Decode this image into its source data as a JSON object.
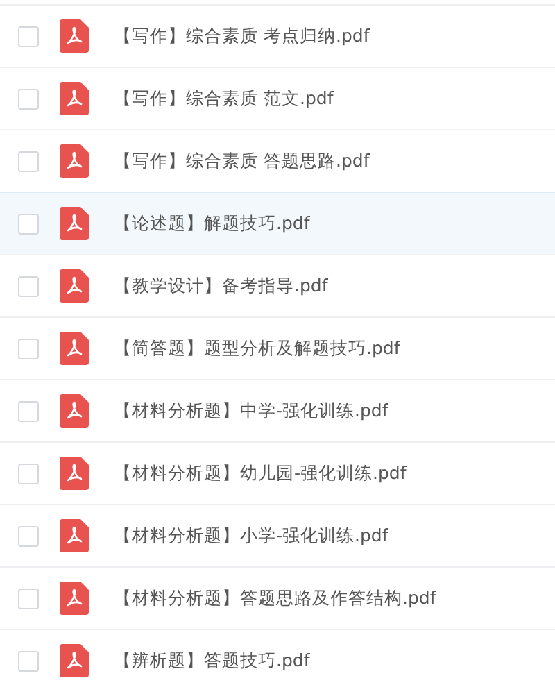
{
  "files": [
    {
      "name": "【写作】综合素质 考点归纳.pdf",
      "checked": false,
      "hovered": false
    },
    {
      "name": "【写作】综合素质 范文.pdf",
      "checked": false,
      "hovered": false
    },
    {
      "name": "【写作】综合素质 答题思路.pdf",
      "checked": false,
      "hovered": false
    },
    {
      "name": "【论述题】解题技巧.pdf",
      "checked": false,
      "hovered": true
    },
    {
      "name": "【教学设计】备考指导.pdf",
      "checked": false,
      "hovered": false
    },
    {
      "name": "【简答题】题型分析及解题技巧.pdf",
      "checked": false,
      "hovered": false
    },
    {
      "name": "【材料分析题】中学-强化训练.pdf",
      "checked": false,
      "hovered": false
    },
    {
      "name": "【材料分析题】幼儿园-强化训练.pdf",
      "checked": false,
      "hovered": false
    },
    {
      "name": "【材料分析题】小学-强化训练.pdf",
      "checked": false,
      "hovered": false
    },
    {
      "name": "【材料分析题】答题思路及作答结构.pdf",
      "checked": false,
      "hovered": false
    },
    {
      "name": "【辨析题】答题技巧.pdf",
      "checked": false,
      "hovered": false
    }
  ]
}
